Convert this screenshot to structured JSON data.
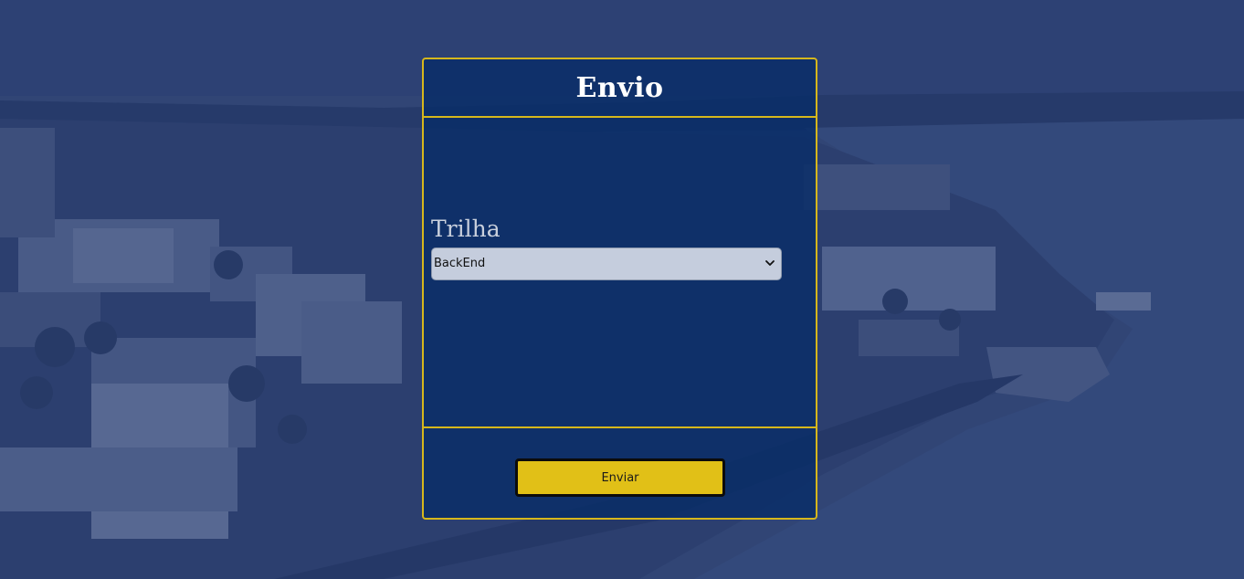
{
  "form": {
    "title": "Envio",
    "field_label": "Trilha",
    "select_value": "BackEnd",
    "submit_label": "Enviar"
  },
  "colors": {
    "card_background": "#082d68",
    "card_border": "#d6b71c",
    "button_background": "#e1c017",
    "title_text": "#ffffff",
    "label_text": "#c9d0dd"
  },
  "icons": {
    "select_arrow": "chevron-down-icon"
  }
}
